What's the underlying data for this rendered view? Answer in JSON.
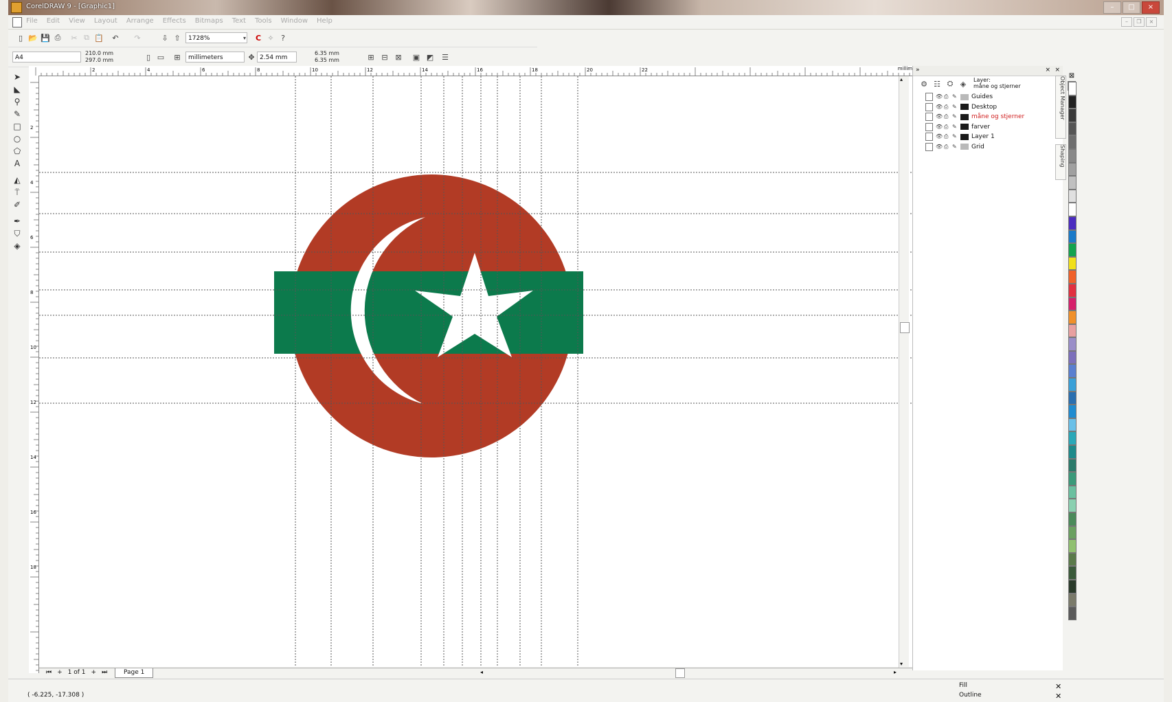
{
  "window": {
    "title": "CorelDRAW 9 - [Graphic1]",
    "min": "–",
    "max": "□",
    "close": "×"
  },
  "menu": [
    "File",
    "Edit",
    "View",
    "Layout",
    "Arrange",
    "Effects",
    "Bitmaps",
    "Text",
    "Tools",
    "Window",
    "Help"
  ],
  "toolbar": {
    "zoom_value": "1728%"
  },
  "property_bar": {
    "paper": "A4",
    "width": "210.0 mm",
    "height": "297.0 mm",
    "units": "millimeters",
    "nudge": "2.54 mm",
    "dup_x": "6.35 mm",
    "dup_y": "6.35 mm"
  },
  "ruler": {
    "unit_label": "millimeters",
    "h_ticks": [
      "2",
      "4",
      "6",
      "8",
      "10",
      "12",
      "14",
      "16",
      "18",
      "20",
      "22"
    ],
    "v_ticks": [
      "2",
      "4",
      "6",
      "8",
      "10",
      "12",
      "14",
      "16",
      "18"
    ]
  },
  "docker": {
    "header_label": "Layer:",
    "current_layer": "måne og stjerner",
    "layers": [
      {
        "name": "Guides",
        "color": "#b9b9b9",
        "active": false
      },
      {
        "name": "Desktop",
        "color": "#1a1a1a",
        "active": false
      },
      {
        "name": "måne og stjerner",
        "color": "#1a1a1a",
        "active": true
      },
      {
        "name": "farver",
        "color": "#1a1a1a",
        "active": false
      },
      {
        "name": "Layer 1",
        "color": "#1a1a1a",
        "active": false
      },
      {
        "name": "Grid",
        "color": "#b9b9b9",
        "active": false
      }
    ],
    "tab_object_manager": "Object Manager",
    "tab_shaping": "Shaping"
  },
  "artwork": {
    "circle_color": "#b23b25",
    "band_color": "#0c7a4c",
    "white": "#ffffff"
  },
  "page_nav": {
    "counter": "1 of 1",
    "page_tab": "Page 1"
  },
  "status": {
    "coords": "( -6.225, -17.308 )",
    "fill_label": "Fill",
    "outline_label": "Outline"
  },
  "palette_colors": [
    "#ffffff",
    "#222222",
    "#3a3a3a",
    "#555555",
    "#6e6e6e",
    "#888888",
    "#a0a0a0",
    "#c0c0c0",
    "#e0e0e0",
    "#ffffff",
    "#4b2cc0",
    "#1a7ac9",
    "#13a34e",
    "#f1e01b",
    "#f0612a",
    "#e23040",
    "#d6206b",
    "#f0902a",
    "#e8a0a0",
    "#9a8ec8",
    "#7c6fbb",
    "#5a7fd0",
    "#3aa0d8",
    "#2a6fb0",
    "#1f8bd0",
    "#6ac0e8",
    "#2aa8b8",
    "#1d8a8a",
    "#2a7a6a",
    "#3a9a7a",
    "#6ac0a0",
    "#8ad0b0",
    "#4a8a5a",
    "#6aa060",
    "#90c070",
    "#5a7a4a",
    "#3a5a3a",
    "#2a3a2a",
    "#7a7a6a",
    "#5a5a5a"
  ]
}
